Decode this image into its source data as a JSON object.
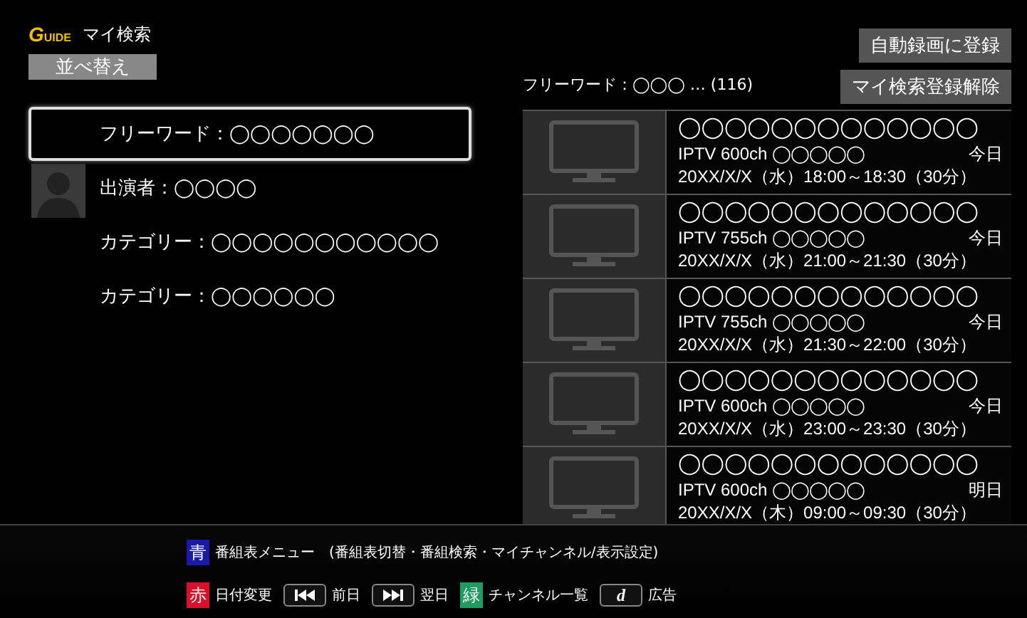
{
  "header": {
    "logo": "G",
    "logo_rest": "UIDE",
    "title": "マイ検索"
  },
  "sort_button": "並べ替え",
  "buttons": [
    "自動録画に登録",
    "マイ検索登録解除"
  ],
  "result_summary": "フリーワード：◯◯◯ … (116)",
  "searches": [
    {
      "label": "フリーワード：◯◯◯◯◯◯◯",
      "kind": "keyword",
      "selected": true
    },
    {
      "label": "出演者：◯◯◯◯",
      "kind": "performer",
      "selected": false
    },
    {
      "label": "カテゴリー：◯◯◯◯◯◯◯◯◯◯◯",
      "kind": "category",
      "selected": false
    },
    {
      "label": "カテゴリー：◯◯◯◯◯◯",
      "kind": "category",
      "selected": false
    }
  ],
  "programs": [
    {
      "title": "◯◯◯◯◯◯◯◯◯◯◯◯◯",
      "channel": "IPTV 600ch ◯◯◯◯◯",
      "day": "今日",
      "time": "20XX/X/X（水）18:00～18:30（30分）"
    },
    {
      "title": "◯◯◯◯◯◯◯◯◯◯◯◯◯",
      "channel": "IPTV 755ch ◯◯◯◯◯",
      "day": "今日",
      "time": "20XX/X/X（水）21:00～21:30（30分）"
    },
    {
      "title": "◯◯◯◯◯◯◯◯◯◯◯◯◯",
      "channel": "IPTV 755ch ◯◯◯◯◯",
      "day": "今日",
      "time": "20XX/X/X（水）21:30～22:00（30分）"
    },
    {
      "title": "◯◯◯◯◯◯◯◯◯◯◯◯◯",
      "channel": "IPTV 600ch ◯◯◯◯◯",
      "day": "今日",
      "time": "20XX/X/X（水）23:00～23:30（30分）"
    },
    {
      "title": "◯◯◯◯◯◯◯◯◯◯◯◯◯",
      "channel": "IPTV 600ch ◯◯◯◯◯",
      "day": "明日",
      "time": "20XX/X/X（木）09:00～09:30（30分）"
    }
  ],
  "guide": [
    [
      {
        "kind": "color_key",
        "key": "青",
        "color": "#1a1aa8",
        "label": "番組表メニュー　(番組表切替・番組検索・マイチャンネル/表示設定)"
      }
    ],
    [
      {
        "kind": "color_key",
        "key": "赤",
        "color": "#d8102a",
        "label": "日付変更"
      },
      {
        "kind": "skip_back",
        "label": "前日"
      },
      {
        "kind": "skip_forward",
        "label": "翌日"
      },
      {
        "kind": "color_key",
        "key": "緑",
        "color": "#1f9a60",
        "label": "チャンネル一覧"
      },
      {
        "kind": "letter_key",
        "key": "d",
        "label": "広告"
      }
    ]
  ]
}
